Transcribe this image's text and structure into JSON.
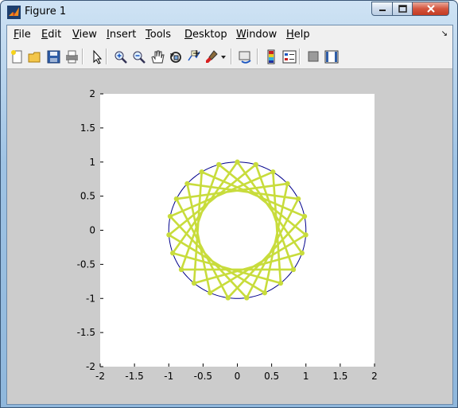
{
  "window": {
    "title": "Figure 1"
  },
  "menubar": {
    "items": [
      {
        "label": "File",
        "key": "file"
      },
      {
        "label": "Edit",
        "key": "edit"
      },
      {
        "label": "View",
        "key": "view"
      },
      {
        "label": "Insert",
        "key": "insert"
      },
      {
        "label": "Tools",
        "key": "tools"
      },
      {
        "label": "Desktop",
        "key": "desktop"
      },
      {
        "label": "Window",
        "key": "window"
      },
      {
        "label": "Help",
        "key": "help"
      }
    ]
  },
  "toolbar": {
    "icons": [
      "new-figure-icon",
      "open-file-icon",
      "save-icon",
      "print-icon",
      "pointer-icon",
      "zoom-in-icon",
      "zoom-out-icon",
      "pan-hand-icon",
      "rotate-3d-icon",
      "data-cursor-icon",
      "brush-icon",
      "brush-dropdown-icon",
      "link-plot-icon",
      "colorbar-icon",
      "legend-icon",
      "hide-plot-tools-icon",
      "show-plot-tools-icon"
    ]
  },
  "colors": {
    "circle": "#00008b",
    "star": "#c8dc3c",
    "axes_bg": "#ffffff",
    "figure_bg": "#cccccc"
  },
  "chart_data": {
    "type": "line",
    "xlim": [
      -2,
      2
    ],
    "ylim": [
      -2,
      2
    ],
    "xticks": [
      "-2",
      "-1.5",
      "-1",
      "-0.5",
      "0",
      "0.5",
      "1",
      "1.5",
      "2"
    ],
    "yticks": [
      "2",
      "1.5",
      "1",
      "0.5",
      "0",
      "-0.5",
      "-1",
      "-1.5",
      "-2"
    ],
    "grid": false,
    "series": [
      {
        "kind": "unit-circle",
        "radius": 1,
        "color": "#00008b"
      },
      {
        "kind": "star-polygon",
        "radius": 1,
        "points": 23,
        "step": 7,
        "color": "#c8dc3c",
        "marker": "dot"
      }
    ]
  }
}
